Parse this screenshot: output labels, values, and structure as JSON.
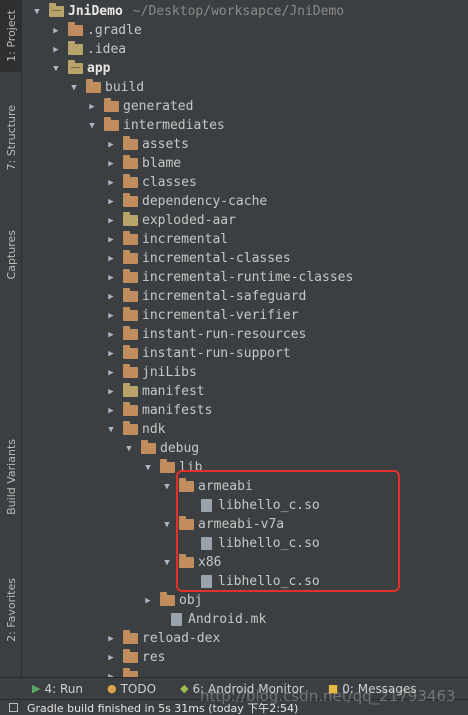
{
  "left_tabs": {
    "project": "1: Project",
    "structure": "7: Structure",
    "captures": "Captures",
    "build_variants": "Build Variants",
    "favorites": "2: Favorites"
  },
  "tree": {
    "root_name": "JniDemo",
    "root_path": "~/Desktop/worksapce/JniDemo",
    "gradle": ".gradle",
    "idea": ".idea",
    "app": "app",
    "build": "build",
    "generated": "generated",
    "intermediates": "intermediates",
    "assets": "assets",
    "blame": "blame",
    "classes": "classes",
    "dependency_cache": "dependency-cache",
    "exploded_aar": "exploded-aar",
    "incremental": "incremental",
    "incremental_classes": "incremental-classes",
    "incremental_runtime_classes": "incremental-runtime-classes",
    "incremental_safeguard": "incremental-safeguard",
    "incremental_verifier": "incremental-verifier",
    "instant_run_resources": "instant-run-resources",
    "instant_run_support": "instant-run-support",
    "jnilibs": "jniLibs",
    "manifest": "manifest",
    "manifests": "manifests",
    "ndk": "ndk",
    "debug": "debug",
    "lib": "lib",
    "armeabi": "armeabi",
    "armeabi_so": "libhello_c.so",
    "armeabi_v7a": "armeabi-v7a",
    "armeabi_v7a_so": "libhello_c.so",
    "x86": "x86",
    "x86_so": "libhello_c.so",
    "obj": "obj",
    "android_mk": "Android.mk",
    "reload_dex": "reload-dex",
    "res": "res"
  },
  "bottom_tabs": {
    "run": "4: Run",
    "todo": "TODO",
    "android_monitor": "6: Android Monitor",
    "messages": "0: Messages"
  },
  "status": {
    "message": "Gradle build finished in 5s 31ms (today 下午2:54)"
  },
  "watermark": "http://blog.csdn.net/qq_21793463"
}
